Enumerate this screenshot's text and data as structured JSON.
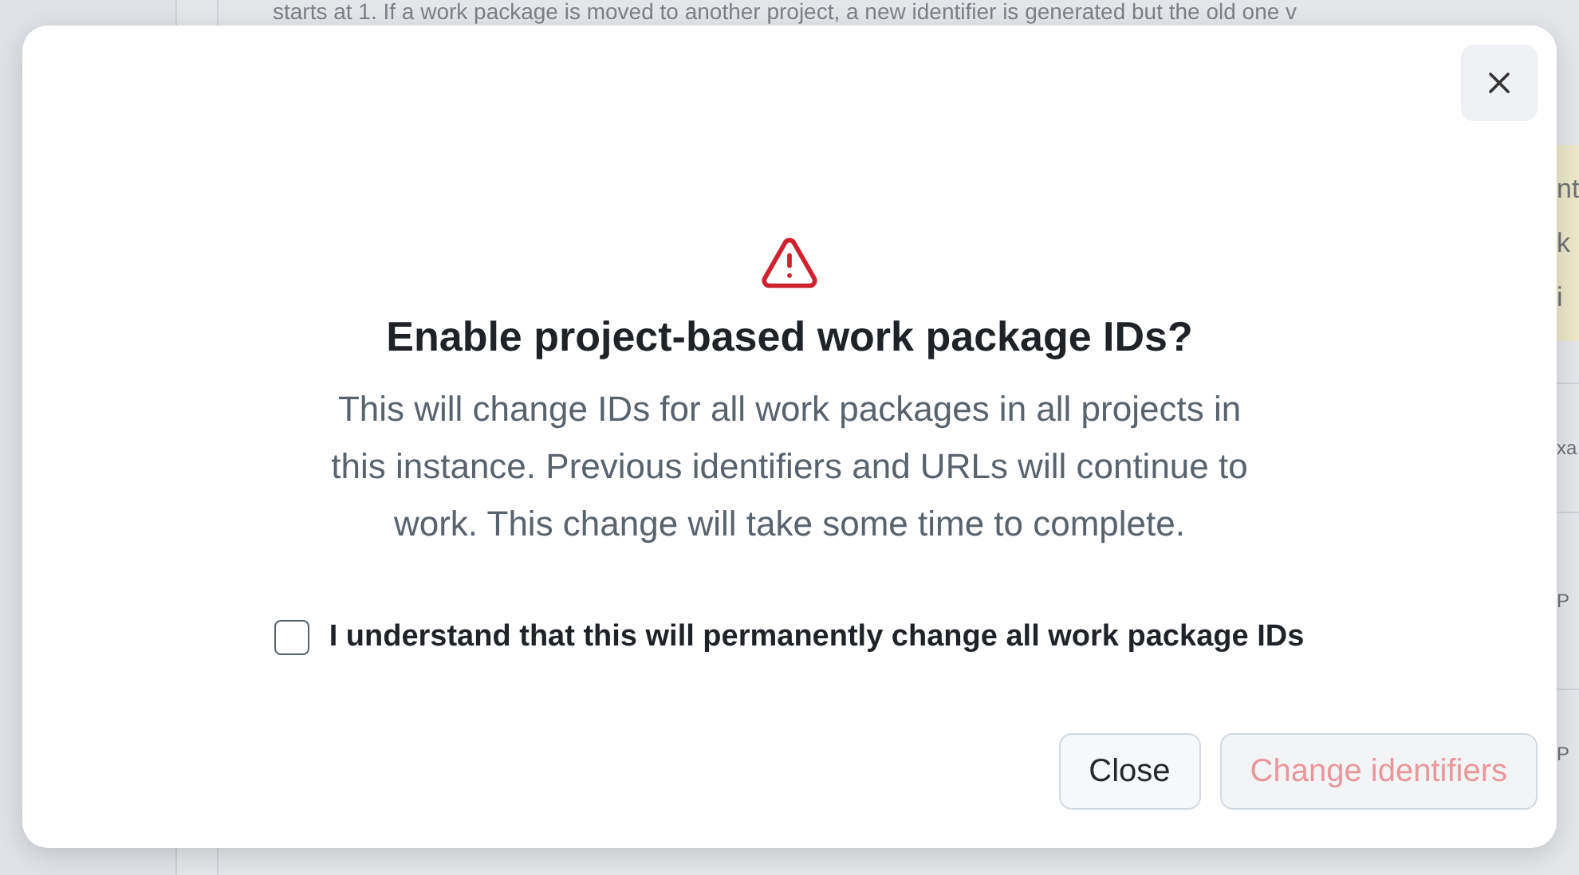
{
  "background": {
    "intro_text": "starts at 1. If a work package is moved to another project, a new identifier is generated but the old one v",
    "notice_fragments": [
      "nt",
      "k",
      "i"
    ],
    "row_fragments": [
      "xa",
      "P",
      "P"
    ]
  },
  "dialog": {
    "title": "Enable project-based work package IDs?",
    "description": "This will change IDs for all work packages in all projects in this instance. Previous identifiers and URLs will continue to work. This change will take some time to complete.",
    "confirmation": {
      "label": "I understand that this will permanently change all work package IDs",
      "checked": false
    },
    "buttons": [
      {
        "label": "Close",
        "kind": "secondary",
        "disabled": false
      },
      {
        "label": "Change identifiers",
        "kind": "danger",
        "disabled": true
      }
    ]
  }
}
